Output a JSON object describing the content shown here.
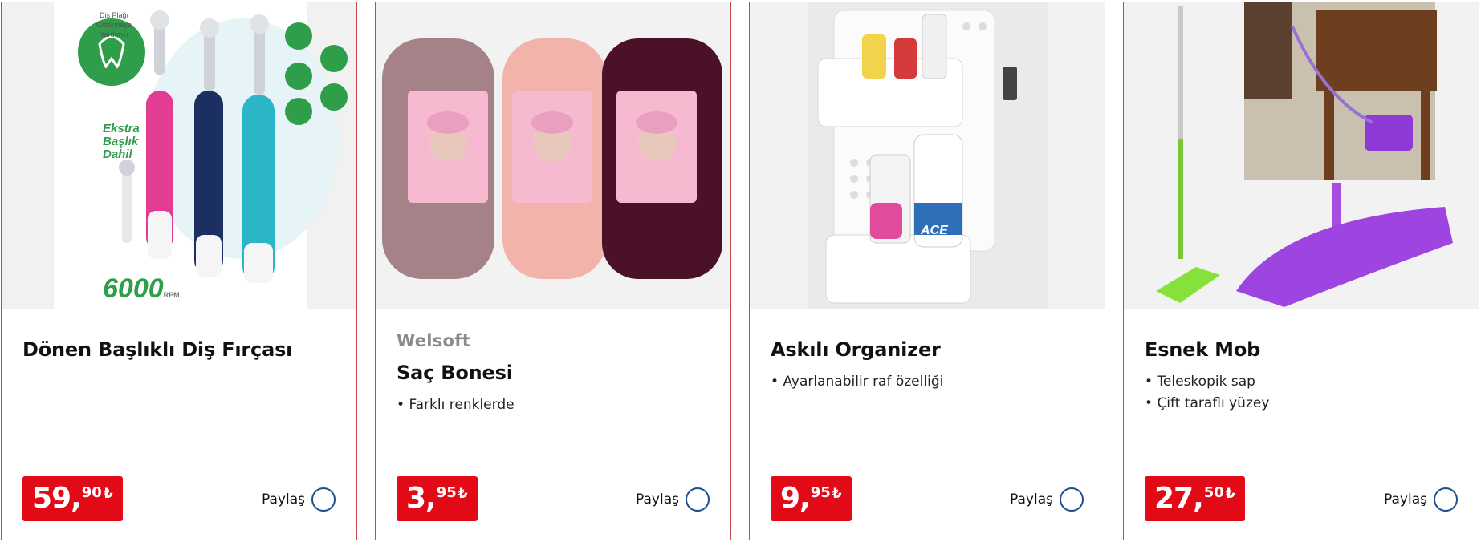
{
  "products": [
    {
      "title": "Dönen Başlıklı Diş Fırçası",
      "brand": "",
      "features": [],
      "price": {
        "whole": "59,",
        "fraction": "90",
        "currency": "₺"
      },
      "share_label": "Paylaş",
      "image_text": {
        "plaque": "Diş Plağı Gidermeye Yardımcı",
        "extra": "Ekstra Başlık Dahil",
        "rpm": "6000",
        "rpm_unit": "RPM"
      }
    },
    {
      "title": "Saç Bonesi",
      "brand": "Welsoft",
      "features": [
        "Farklı renklerde"
      ],
      "price": {
        "whole": "3,",
        "fraction": "95",
        "currency": "₺"
      },
      "share_label": "Paylaş"
    },
    {
      "title": "Askılı Organizer",
      "brand": "",
      "features": [
        "Ayarlanabilir raf özelliği"
      ],
      "price": {
        "whole": "9,",
        "fraction": "95",
        "currency": "₺"
      },
      "share_label": "Paylaş",
      "image_text": {
        "bottle": "ACE"
      }
    },
    {
      "title": "Esnek Mob",
      "brand": "",
      "features": [
        "Teleskopik sap",
        "Çift taraflı yüzey"
      ],
      "price": {
        "whole": "27,",
        "fraction": "50",
        "currency": "₺"
      },
      "share_label": "Paylaş"
    }
  ],
  "colors": {
    "price_bg": "#e30a17",
    "card_border": "#c9484a",
    "share_circle": "#1f4e8c",
    "brand_text": "#8a8a8a"
  },
  "icons": {
    "share": "circle-share-icon"
  }
}
